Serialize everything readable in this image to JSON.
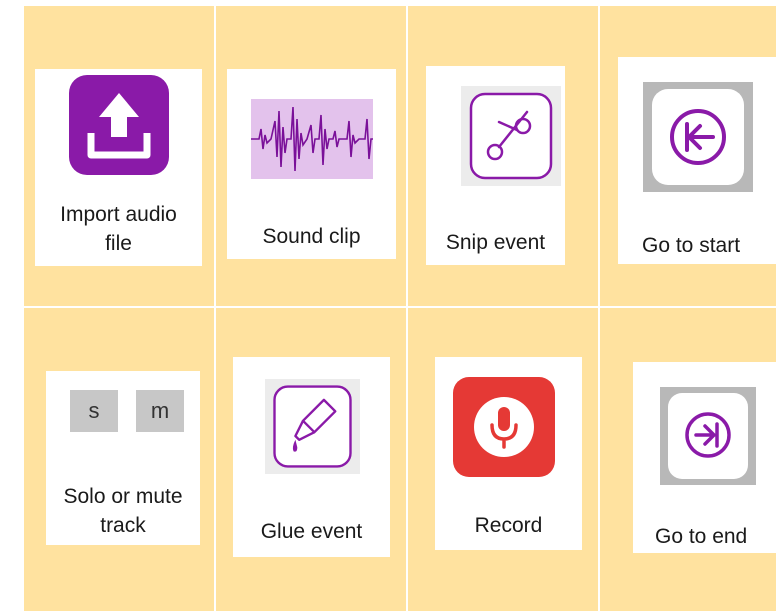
{
  "cells": [
    {
      "id": "import",
      "label": "Import audio\nfile",
      "icon": "upload-icon"
    },
    {
      "id": "sound",
      "label": "Sound clip",
      "icon": "waveform-icon"
    },
    {
      "id": "snip",
      "label": "Snip event",
      "icon": "scissors-icon"
    },
    {
      "id": "start",
      "label": "Go to start",
      "icon": "go-to-start-icon"
    },
    {
      "id": "solo",
      "label": "Solo or mute\ntrack",
      "icon": "solo-mute-icon",
      "buttons": {
        "solo": "s",
        "mute": "m"
      }
    },
    {
      "id": "glue",
      "label": "Glue event",
      "icon": "glue-icon"
    },
    {
      "id": "record",
      "label": "Record",
      "icon": "microphone-icon"
    },
    {
      "id": "end",
      "label": "Go to end",
      "icon": "go-to-end-icon"
    }
  ],
  "colors": {
    "background": "#ffe29f",
    "accent": "#8a1aa8",
    "record": "#e53935",
    "waveform_bg": "#e3c2ec"
  }
}
